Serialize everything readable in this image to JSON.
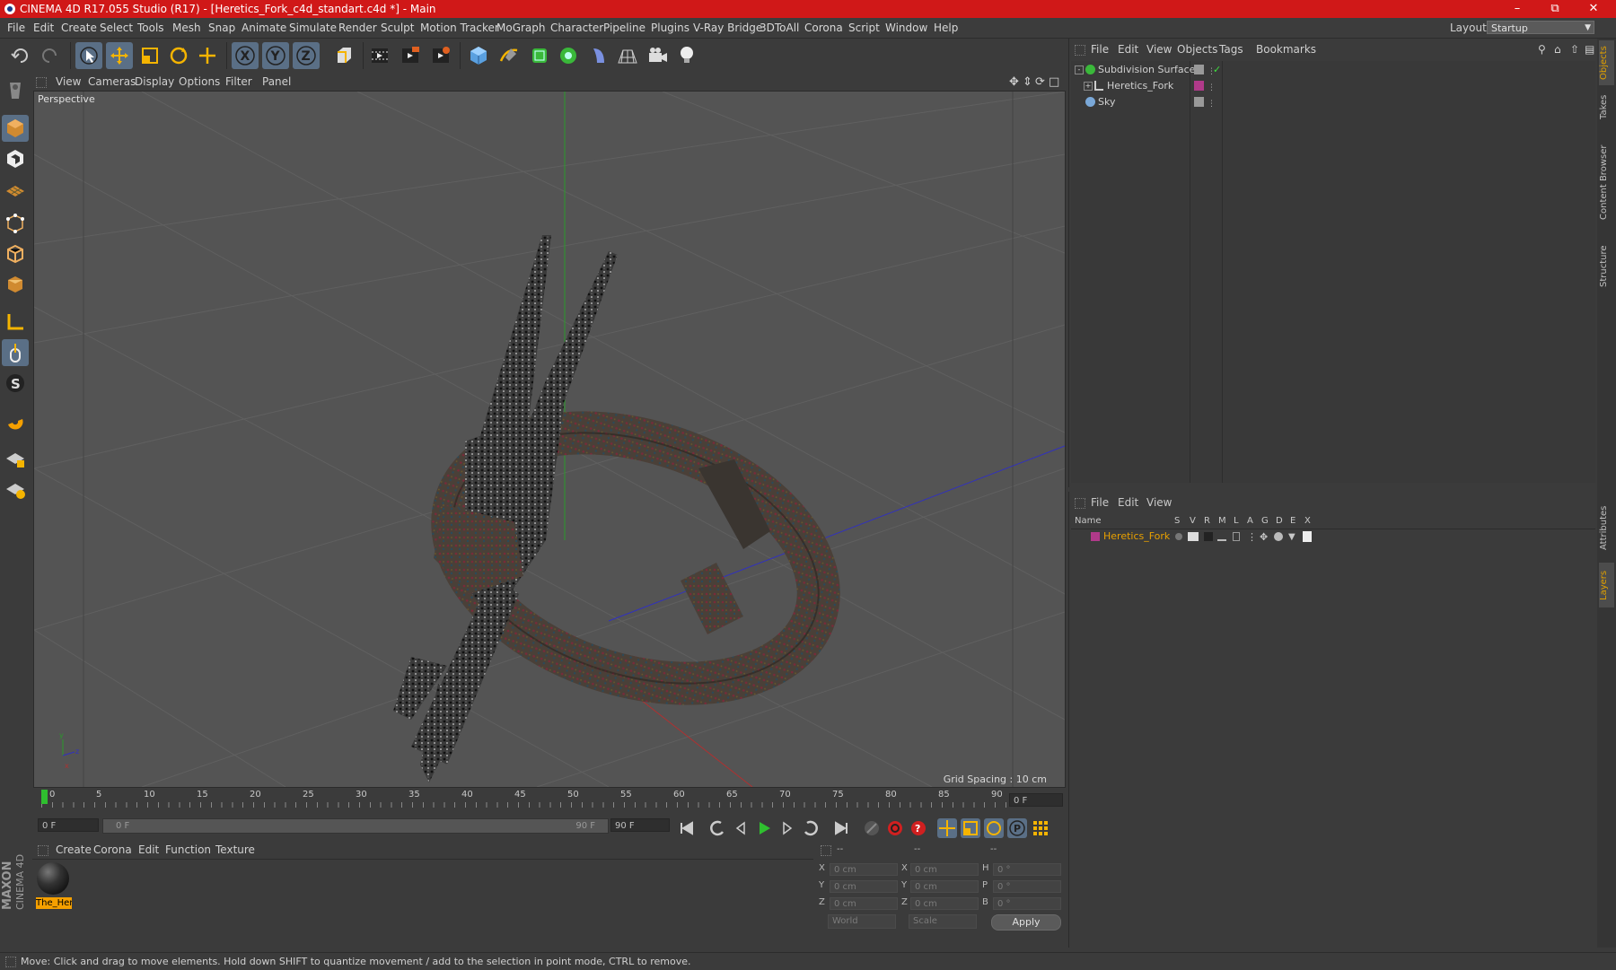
{
  "window": {
    "title": "CINEMA 4D R17.055 Studio (R17) - [Heretics_Fork_c4d_standart.c4d *] - Main"
  },
  "menubar": {
    "items": [
      "File",
      "Edit",
      "Create",
      "Select",
      "Tools",
      "Mesh",
      "Snap",
      "Animate",
      "Simulate",
      "Render",
      "Sculpt",
      "Motion Tracker",
      "MoGraph",
      "Character",
      "Pipeline",
      "Plugins",
      "V-Ray Bridge",
      "3DToAll",
      "Corona",
      "Script",
      "Window",
      "Help"
    ],
    "layout_label": "Layout:",
    "layout_value": "Startup"
  },
  "viewport": {
    "menu": [
      "View",
      "Cameras",
      "Display",
      "Options",
      "Filter",
      "Panel"
    ],
    "label": "Perspective",
    "grid_spacing": "Grid Spacing : 10 cm"
  },
  "timeline": {
    "ticks": [
      "0",
      "5",
      "10",
      "15",
      "20",
      "25",
      "30",
      "35",
      "40",
      "45",
      "50",
      "55",
      "60",
      "65",
      "70",
      "75",
      "80",
      "85",
      "90"
    ],
    "current_frame": "0 F",
    "start_field": "0 F",
    "slider_start": "0 F",
    "slider_end": "90 F",
    "end_field": "90 F"
  },
  "material_manager": {
    "menu": [
      "Create",
      "Corona",
      "Edit",
      "Function",
      "Texture"
    ],
    "material_name": "The_Her"
  },
  "coordinates": {
    "headers": [
      "--",
      "--",
      "--"
    ],
    "rows": [
      {
        "l1": "X",
        "v1": "0 cm",
        "l2": "X",
        "v2": "0 cm",
        "l3": "H",
        "v3": "0 °"
      },
      {
        "l1": "Y",
        "v1": "0 cm",
        "l2": "Y",
        "v2": "0 cm",
        "l3": "P",
        "v3": "0 °"
      },
      {
        "l1": "Z",
        "v1": "0 cm",
        "l2": "Z",
        "v2": "0 cm",
        "l3": "B",
        "v3": "0 °"
      }
    ],
    "mode": "World",
    "scale": "Scale",
    "apply": "Apply"
  },
  "object_manager": {
    "menu": [
      "File",
      "Edit",
      "View",
      "Objects",
      "Tags",
      "Bookmarks"
    ],
    "objects": [
      "Subdivision Surface",
      "Heretics_Fork",
      "Sky"
    ]
  },
  "layer_manager": {
    "menu": [
      "File",
      "Edit",
      "View"
    ],
    "columns": [
      "Name",
      "S",
      "V",
      "R",
      "M",
      "L",
      "A",
      "G",
      "D",
      "E",
      "X"
    ],
    "layer_name": "Heretics_Fork"
  },
  "side_tabs": [
    "Objects",
    "Takes",
    "Content Browser",
    "Structure",
    "Attributes",
    "Layers"
  ],
  "branding": {
    "maxon": "MAXON",
    "cinema": "CINEMA 4D"
  },
  "status": "Move: Click and drag to move elements. Hold down SHIFT to quantize movement / add to the selection in point mode, CTRL to remove."
}
